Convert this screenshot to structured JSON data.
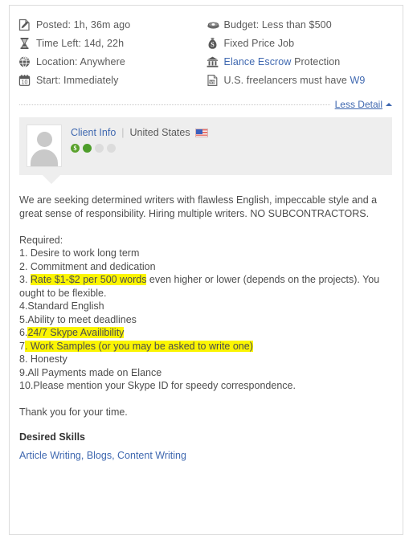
{
  "meta": {
    "left": [
      {
        "icon": "document-pencil-icon",
        "label": "Posted: 1h, 36m ago"
      },
      {
        "icon": "hourglass-icon",
        "label": "Time Left: 14d, 22h"
      },
      {
        "icon": "globe-icon",
        "label": "Location: Anywhere"
      },
      {
        "icon": "calendar-icon",
        "label": "Start: Immediately"
      }
    ],
    "right": [
      {
        "icon": "money-icon",
        "label": "Budget: Less than $500"
      },
      {
        "icon": "moneybag-icon",
        "label": "Fixed Price Job"
      },
      {
        "icon": "bank-icon",
        "label_link": "Elance Escrow",
        "label_rest": " Protection"
      },
      {
        "icon": "w9-form-icon",
        "label_pre": "U.S. freelancers must have ",
        "label_link": "W9"
      }
    ]
  },
  "less_detail": {
    "label": "Less Detail",
    "caret": "caret-up-icon"
  },
  "client": {
    "title": "Client Info",
    "separator": "|",
    "country": "United States",
    "flag": "us-flag-icon",
    "rating_dots": [
      "dollar",
      "on",
      "off",
      "off"
    ]
  },
  "description": {
    "intro": "We are seeking determined writers with flawless English, impeccable style and a great sense of responsibility. Hiring multiple writers. NO SUBCONTRACTORS.",
    "required_heading": "Required:",
    "items": [
      {
        "text": "1. Desire to work long term"
      },
      {
        "text": "2. Commitment and dedication"
      },
      {
        "prefix": "3. ",
        "highlight": "Rate $1-$2 per 500 words",
        "suffix": " even higher or lower (depends on the projects). You ought to be flexible."
      },
      {
        "text": "4.Standard English"
      },
      {
        "text": "5.Ability to meet deadlines"
      },
      {
        "prefix": "6.",
        "highlight": "24/7 Skype Availibility",
        "suffix": ""
      },
      {
        "prefix": "7",
        "highlight": ". Work Samples (or you may be asked to write one)",
        "suffix": ""
      },
      {
        "text": "8. Honesty"
      },
      {
        "text": "9.All Payments made on Elance"
      },
      {
        "text": "10.Please mention your Skype ID for speedy correspondence."
      }
    ],
    "closing": "Thank you for your time."
  },
  "skills": {
    "heading": "Desired Skills",
    "list": "Article Writing, Blogs, Content Writing"
  },
  "colors": {
    "link": "#3f68b0",
    "text": "#4d4d4d",
    "highlight": "#fbf502",
    "client_box": "#eeeeee",
    "border": "#dcdcdc"
  }
}
